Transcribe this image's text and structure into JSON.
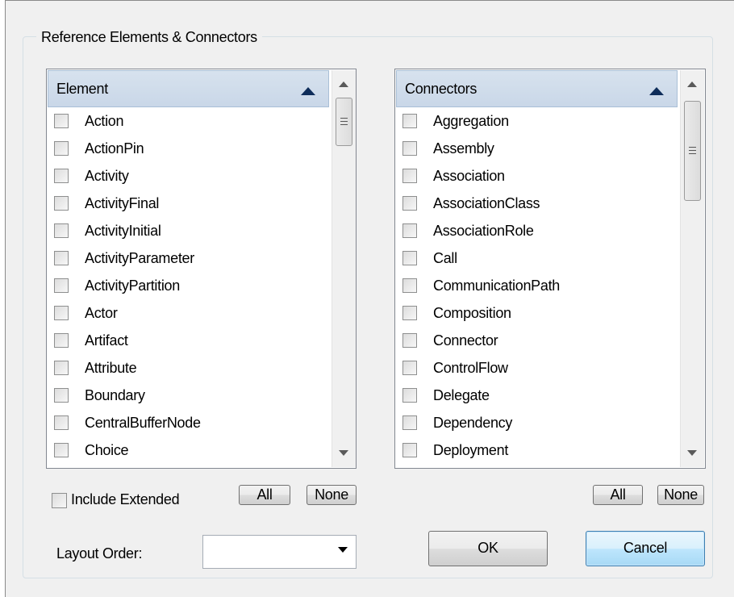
{
  "group": {
    "title": "Reference Elements & Connectors"
  },
  "elements": {
    "header": "Element",
    "items": [
      {
        "label": "Action",
        "checked": false
      },
      {
        "label": "ActionPin",
        "checked": false
      },
      {
        "label": "Activity",
        "checked": false
      },
      {
        "label": "ActivityFinal",
        "checked": false
      },
      {
        "label": "ActivityInitial",
        "checked": false
      },
      {
        "label": "ActivityParameter",
        "checked": false
      },
      {
        "label": "ActivityPartition",
        "checked": false
      },
      {
        "label": "Actor",
        "checked": false
      },
      {
        "label": "Artifact",
        "checked": false
      },
      {
        "label": "Attribute",
        "checked": false
      },
      {
        "label": "Boundary",
        "checked": false
      },
      {
        "label": "CentralBufferNode",
        "checked": false
      },
      {
        "label": "Choice",
        "checked": false
      }
    ],
    "all_label": "All",
    "none_label": "None"
  },
  "connectors": {
    "header": "Connectors",
    "items": [
      {
        "label": "Aggregation",
        "checked": false
      },
      {
        "label": "Assembly",
        "checked": false
      },
      {
        "label": "Association",
        "checked": false
      },
      {
        "label": "AssociationClass",
        "checked": false
      },
      {
        "label": "AssociationRole",
        "checked": false
      },
      {
        "label": "Call",
        "checked": false
      },
      {
        "label": "CommunicationPath",
        "checked": false
      },
      {
        "label": "Composition",
        "checked": false
      },
      {
        "label": "Connector",
        "checked": false
      },
      {
        "label": "ControlFlow",
        "checked": false
      },
      {
        "label": "Delegate",
        "checked": false
      },
      {
        "label": "Dependency",
        "checked": false
      },
      {
        "label": "Deployment",
        "checked": false
      }
    ],
    "all_label": "All",
    "none_label": "None"
  },
  "include_extended": {
    "label": "Include Extended",
    "checked": false
  },
  "layout_order": {
    "label": "Layout Order:",
    "value": ""
  },
  "buttons": {
    "ok": "OK",
    "cancel": "Cancel"
  },
  "icons": [
    "sort-ascending-icon",
    "scroll-up-icon",
    "scroll-down-icon",
    "dropdown-arrow-icon",
    "checkbox-icon"
  ],
  "colors": {
    "header_bg": "#c9d7e8",
    "sort_arrow": "#0e2d5a",
    "dialog_bg": "#f0f0f0"
  }
}
